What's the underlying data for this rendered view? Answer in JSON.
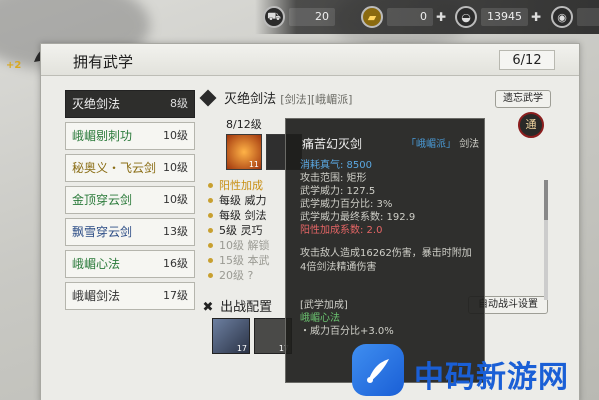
{
  "resources": [
    {
      "icon": "cart-icon",
      "value": "20"
    },
    {
      "icon": "gold-bar-icon",
      "value": "0"
    },
    {
      "icon": "silver-ingot-icon",
      "value": "13945"
    },
    {
      "icon": "coin-icon",
      "value": "0"
    }
  ],
  "header": {
    "plus_label": "+2",
    "title": "拥有武学",
    "count": "6/12"
  },
  "skills": [
    {
      "name": "灭绝剑法",
      "level": "8级",
      "selected": true,
      "color": "white"
    },
    {
      "name": "峨嵋剔刺功",
      "level": "10级",
      "color": "green"
    },
    {
      "name": "秘奥义・飞云剑",
      "level": "10级",
      "color": "yellow"
    },
    {
      "name": "金顶穿云剑",
      "level": "10级",
      "color": "green"
    },
    {
      "name": "飘雪穿云剑",
      "level": "13级",
      "color": "blue"
    },
    {
      "name": "峨嵋心法",
      "level": "16级",
      "color": "green"
    },
    {
      "name": "峨嵋剑法",
      "level": "17级",
      "color": "white"
    }
  ],
  "detail": {
    "name": "灭绝剑法",
    "tags": "[剑法][峨嵋派]",
    "prev_button": "遗忘武学",
    "seal_text": "通",
    "progress": "8/12级",
    "icon_counts": [
      "11"
    ],
    "effects": [
      {
        "text": "阳性加成",
        "style": "highlight"
      },
      {
        "text": "每级  威力",
        "style": "normal"
      },
      {
        "text": "每级  剑法",
        "style": "normal"
      },
      {
        "text": "5级  灵巧",
        "style": "normal"
      },
      {
        "text": "10级  解锁",
        "style": "dim"
      },
      {
        "text": "15级  本武",
        "style": "dim"
      },
      {
        "text": "20级  ?",
        "style": "dim"
      }
    ],
    "deploy_title": "出战配置",
    "auto_button": "自动战斗设置",
    "deploy_counts": [
      "17",
      "17"
    ]
  },
  "tooltip": {
    "name": "痛苦幻灭剑",
    "sect": "「峨嵋派」",
    "type": "剑法",
    "lines": [
      {
        "text": "消耗真气: 8500",
        "style": "blue"
      },
      {
        "text": "攻击范围: 矩形",
        "style": "normal"
      },
      {
        "text": "武学威力: 127.5",
        "style": "normal"
      },
      {
        "text": "武学威力百分比: 3%",
        "style": "normal"
      },
      {
        "text": "武学威力最终系数: 192.9",
        "style": "normal"
      },
      {
        "text": "阳性加成系数: 2.0",
        "style": "red"
      }
    ],
    "description": "攻击敌人造成16262伤害，暴击时附加4倍剑法精通伤害",
    "bonus_title": "[武学加成]",
    "bonus_skill": "峨嵋心法",
    "bonus_value": "・威力百分比+3.0%"
  },
  "watermark": {
    "text": "中码新游网"
  }
}
